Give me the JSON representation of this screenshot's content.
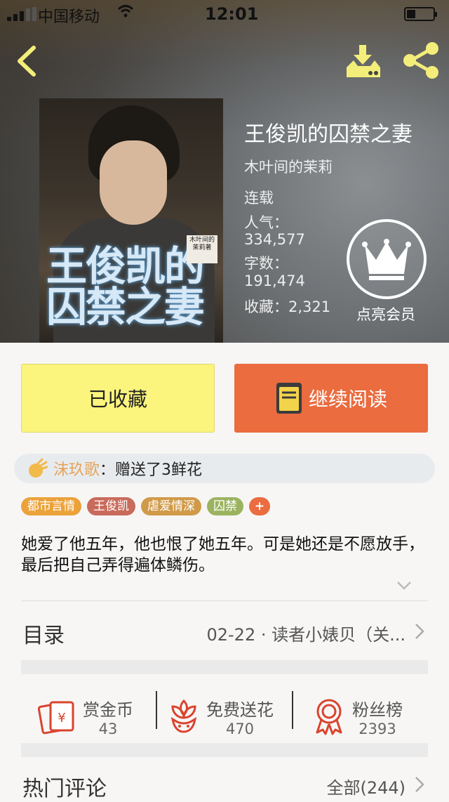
{
  "status_bar": {
    "carrier": "中国移动",
    "time": "12:01"
  },
  "book": {
    "title": "王俊凯的囚禁之妻",
    "author": "木叶间的茉莉",
    "status": "连载",
    "popularity_label": "人气：",
    "popularity_value": "334,577",
    "wordcount_label": "字数：",
    "wordcount_value": "191,474",
    "favorites": "收藏：2,321",
    "cover_title": "王俊凯的囚禁之妻",
    "cover_stamp": "木叶间的茉莉著"
  },
  "vip": {
    "label": "点亮会员"
  },
  "buttons": {
    "collected": "已收藏",
    "continue": "继续阅读"
  },
  "gift": {
    "user": "沫玖歌",
    "text": "：赠送了3鲜花"
  },
  "tags": [
    {
      "label": "都市言情",
      "color": "#eba23a"
    },
    {
      "label": "王俊凯",
      "color": "#c86b5b"
    },
    {
      "label": "虐爱情深",
      "color": "#d09a48"
    },
    {
      "label": "囚禁",
      "color": "#9bb35f"
    },
    {
      "label": "+",
      "color": "#ea6c3f"
    }
  ],
  "description": "她爱了他五年，他也恨了她五年。可是她还是不愿放手，最后把自己弄得遍体鳞伤。",
  "catalog": {
    "label": "目录",
    "latest": "02-22 · 读者小婊贝（关..."
  },
  "actions": [
    {
      "label": "赏金币",
      "count": "43",
      "icon": "red-envelope-icon"
    },
    {
      "label": "免费送花",
      "count": "470",
      "icon": "flower-icon"
    },
    {
      "label": "粉丝榜",
      "count": "2393",
      "icon": "medal-icon"
    }
  ],
  "comments": {
    "title": "热门评论",
    "all": "全部(244)"
  },
  "colors": {
    "accent": "#ea6c3f",
    "collected_bg": "#fbf47d",
    "icon_yellow": "#f3ee7a",
    "icon_red": "#d9442e"
  }
}
